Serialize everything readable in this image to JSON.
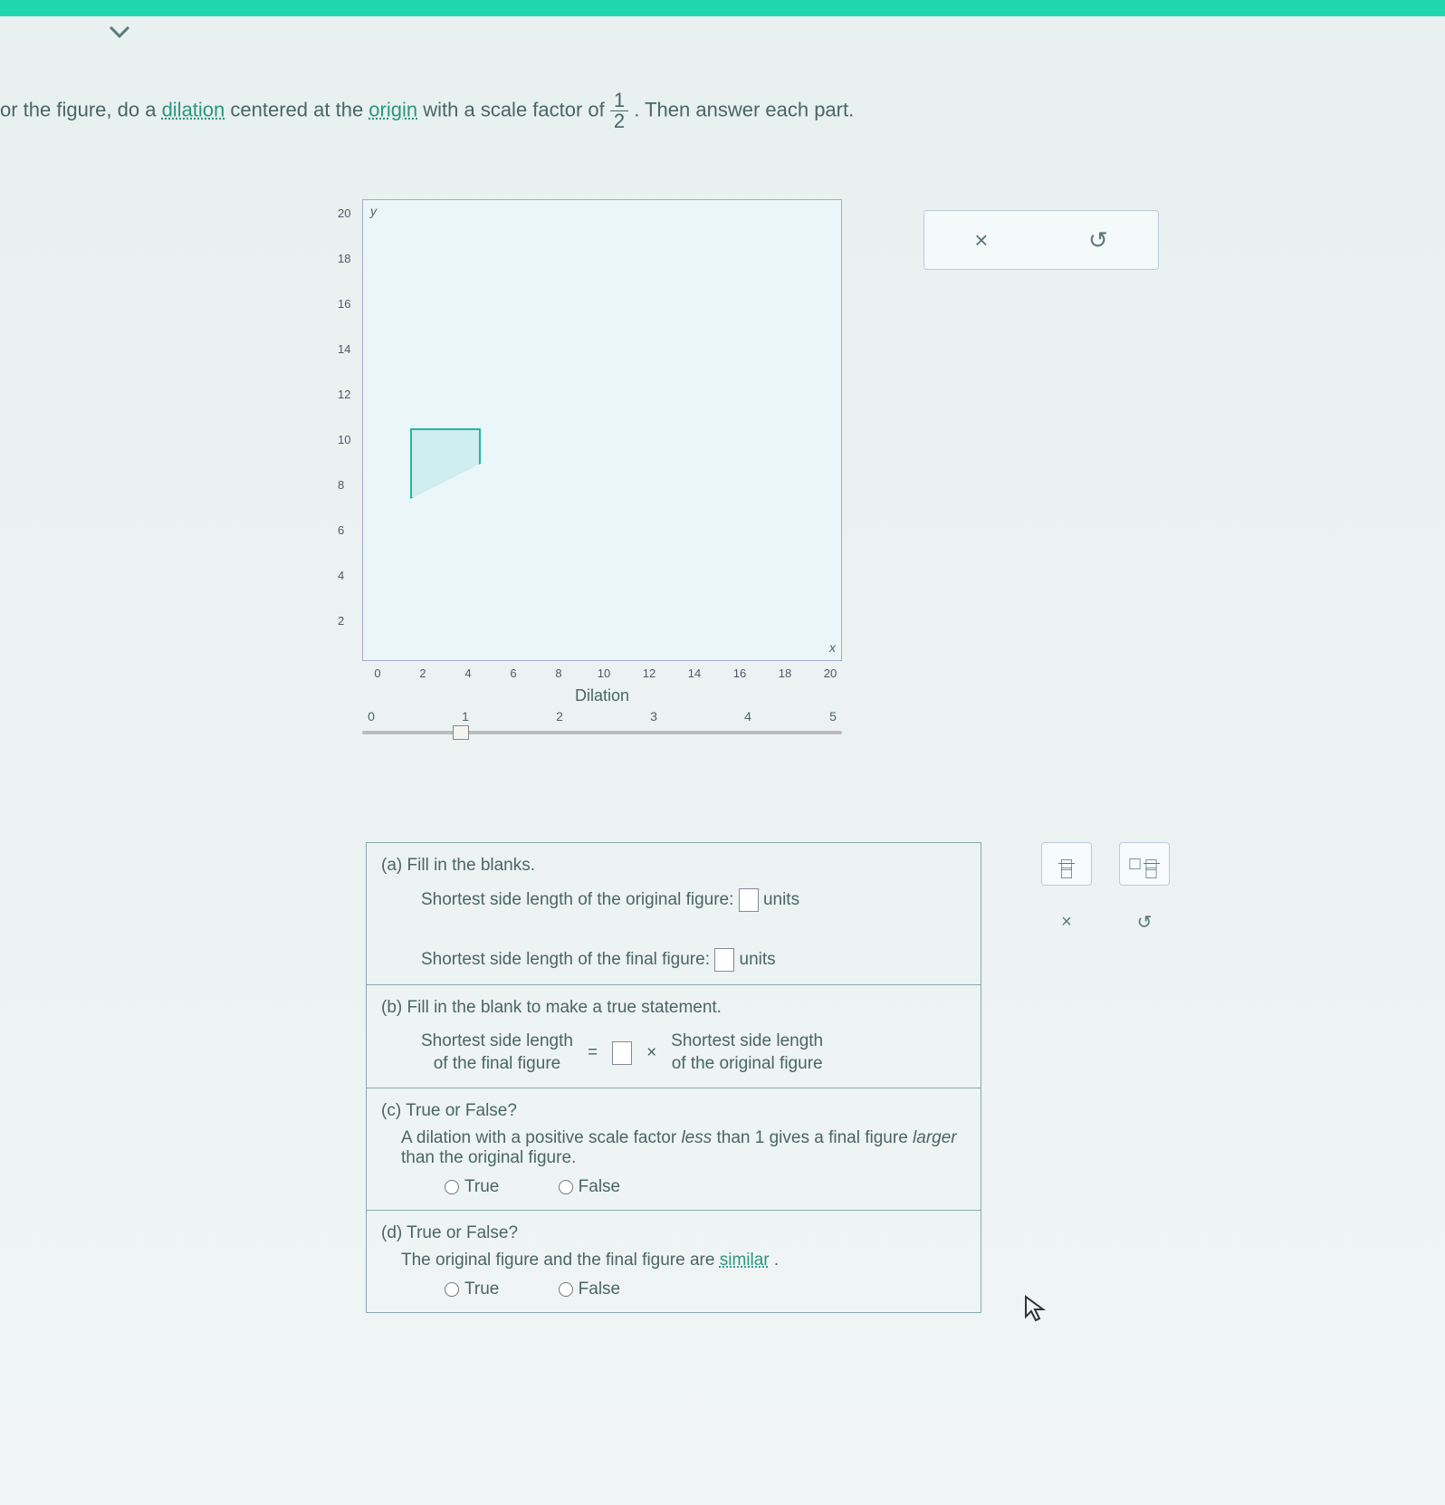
{
  "instruction": {
    "prefix": "or the figure, do a ",
    "link1": "dilation",
    "mid": " centered at the ",
    "link2": "origin",
    "suffix1": " with a scale factor of ",
    "frac_num": "1",
    "frac_den": "2",
    "suffix2": ". Then answer each part."
  },
  "chart_data": {
    "type": "scatter",
    "title": "",
    "xlabel": "x",
    "ylabel": "y",
    "xlim": [
      0,
      20
    ],
    "ylim": [
      0,
      20
    ],
    "x_ticks": [
      0,
      2,
      4,
      6,
      8,
      10,
      12,
      14,
      16,
      18,
      20
    ],
    "y_ticks": [
      2,
      4,
      6,
      8,
      10,
      12,
      14,
      16,
      18,
      20
    ],
    "figure_vertices": [
      [
        2,
        10
      ],
      [
        5,
        10
      ],
      [
        5,
        8.5
      ],
      [
        2,
        7
      ]
    ],
    "description": "Quadrilateral plotted on first-quadrant grid"
  },
  "slider": {
    "title": "Dilation",
    "ticks": [
      "0",
      "1",
      "2",
      "3",
      "4",
      "5"
    ],
    "value": 1
  },
  "toolbar_top": {
    "close": "×",
    "reset": "↺"
  },
  "questions": {
    "a": {
      "label": "(a)",
      "prompt": "Fill in the blanks.",
      "line1_pre": "Shortest side length of the original figure:",
      "line1_post": "units",
      "line2_pre": "Shortest side length of the final figure:",
      "line2_post": "units"
    },
    "b": {
      "label": "(b)",
      "prompt": "Fill in the blank to make a true statement.",
      "left_top": "Shortest side length",
      "left_bot": "of the final figure",
      "eq": "=",
      "times": "×",
      "right_top": "Shortest side length",
      "right_bot": "of the original figure"
    },
    "c": {
      "label": "(c)",
      "prompt": "True or False?",
      "stmt1": "A dilation with a positive scale factor ",
      "em1": "less",
      "stmt2": " than 1 gives a final figure ",
      "em2": "larger",
      "stmt3": " than the original figure.",
      "opt_true": "True",
      "opt_false": "False"
    },
    "d": {
      "label": "(d)",
      "prompt": "True or False?",
      "stmt1": "The original figure and the final figure are ",
      "link": "similar",
      "stmt2": ".",
      "opt_true": "True",
      "opt_false": "False"
    }
  },
  "side_tools": {
    "close": "×",
    "reset": "↺"
  }
}
